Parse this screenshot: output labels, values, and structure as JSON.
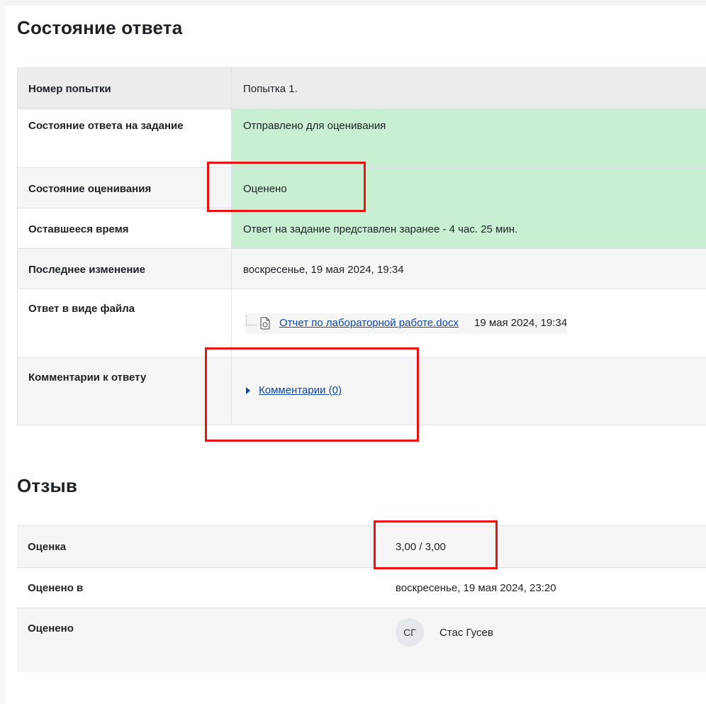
{
  "submission_status": {
    "title": "Состояние ответа",
    "rows": [
      {
        "label": "Номер попытки",
        "value": "Попытка 1."
      },
      {
        "label": "Состояние ответа на задание",
        "value": "Отправлено для оценивания"
      },
      {
        "label": "Состояние оценивания",
        "value": "Оценено"
      },
      {
        "label": "Оставшееся время",
        "value": "Ответ на задание представлен заранее - 4 час. 25 мин."
      },
      {
        "label": "Последнее изменение",
        "value": "воскресенье, 19 мая 2024, 19:34"
      },
      {
        "label": "Ответ в виде файла",
        "file_name": "Отчет по лабораторной работе.docx",
        "file_date": "19 мая 2024, 19:34"
      },
      {
        "label": "Комментарии к ответу",
        "link": "Комментарии (0)"
      }
    ]
  },
  "feedback": {
    "title": "Отзыв",
    "rows": [
      {
        "label": "Оценка",
        "value": "3,00 / 3,00"
      },
      {
        "label": "Оценено в",
        "value": "воскресенье, 19 мая 2024, 23:20"
      },
      {
        "label": "Оценено",
        "avatar": "СГ",
        "value": "Стас Гусев"
      }
    ]
  },
  "colors": {
    "success_green": "#c8efd1",
    "link_blue": "#0f47ad",
    "highlight_red": "#ee1111"
  }
}
